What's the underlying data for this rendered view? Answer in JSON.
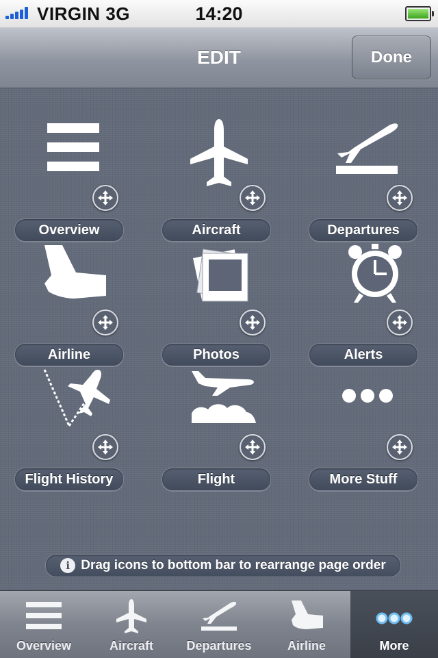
{
  "status_bar": {
    "carrier": "VIRGIN",
    "network": "3G",
    "time": "14:20",
    "battery_color": "#3aa51a",
    "signal_color": "#1d5fd6"
  },
  "nav": {
    "title": "EDIT",
    "done_label": "Done"
  },
  "grid": {
    "items": [
      {
        "label": "Overview",
        "icon": "overview-lines-icon"
      },
      {
        "label": "Aircraft",
        "icon": "airplane-icon"
      },
      {
        "label": "Departures",
        "icon": "departures-icon"
      },
      {
        "label": "Airline",
        "icon": "airline-tail-icon"
      },
      {
        "label": "Photos",
        "icon": "photos-icon"
      },
      {
        "label": "Alerts",
        "icon": "alarm-clock-icon"
      },
      {
        "label": "Flight History",
        "icon": "flight-history-icon"
      },
      {
        "label": "Flight",
        "icon": "flight-icon"
      },
      {
        "label": "More Stuff",
        "icon": "more-dots-icon"
      }
    ],
    "move_icon": "move-arrows-icon"
  },
  "hint": {
    "text": "Drag icons to bottom bar to rearrange page order",
    "info_glyph": "i"
  },
  "tabbar": {
    "tabs": [
      {
        "label": "Overview",
        "icon": "overview-lines-icon"
      },
      {
        "label": "Aircraft",
        "icon": "airplane-icon"
      },
      {
        "label": "Departures",
        "icon": "departures-icon"
      },
      {
        "label": "Airline",
        "icon": "airline-tail-icon"
      },
      {
        "label": "More",
        "icon": "more-dots-icon",
        "active": true
      }
    ],
    "active_dot_color": "#6fbcf0"
  }
}
